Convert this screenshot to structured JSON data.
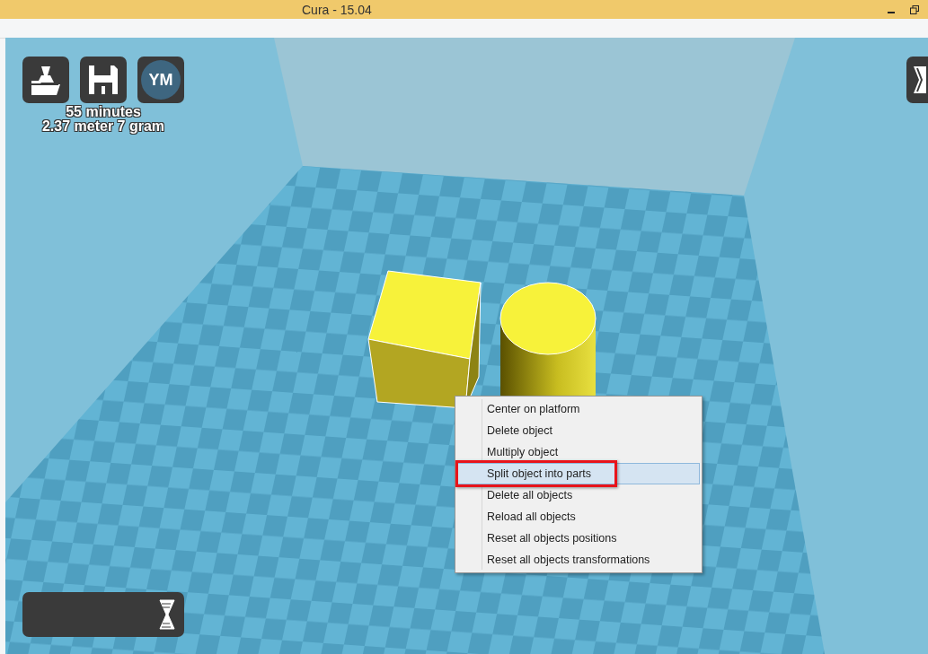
{
  "window": {
    "title": "Cura - 15.04"
  },
  "print_info": {
    "time": "55 minutes",
    "material": "2.37 meter 7 gram"
  },
  "top_toolbar": {
    "avatar_initials": "YM"
  },
  "context_menu": {
    "items": [
      {
        "label": "Center on platform",
        "selected": false,
        "marked": false
      },
      {
        "label": "Delete object",
        "selected": false,
        "marked": false
      },
      {
        "label": "Multiply object",
        "selected": false,
        "marked": false
      },
      {
        "label": "Split object into parts",
        "selected": true,
        "marked": true
      },
      {
        "label": "Delete all objects",
        "selected": false,
        "marked": false
      },
      {
        "label": "Reload all objects",
        "selected": false,
        "marked": false
      },
      {
        "label": "Reset all objects positions",
        "selected": false,
        "marked": false
      },
      {
        "label": "Reset all objects transformations",
        "selected": false,
        "marked": false
      }
    ]
  }
}
